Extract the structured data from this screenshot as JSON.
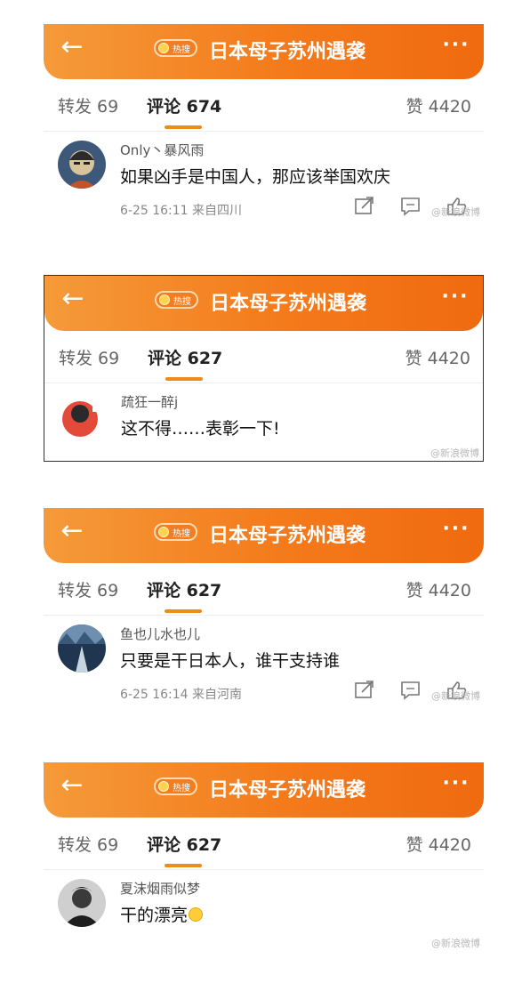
{
  "header": {
    "badge_text": "热搜",
    "title": "日本母子苏州遇袭",
    "back_icon": "arrow-left-icon",
    "more_icon": "more-dots-icon",
    "accent": "#f47a1a"
  },
  "panels": [
    {
      "tabs": {
        "repost": "转发 69",
        "comments": "评论 674",
        "likes": "赞 4420"
      },
      "comment": {
        "username": "Only丶暴风雨",
        "text": "如果凶手是中国人，那应该举国欢庆",
        "meta": "6-25 16:11 来自四川"
      },
      "watermark": "@新浪微博"
    },
    {
      "tabs": {
        "repost": "转发 69",
        "comments": "评论 627",
        "likes": "赞 4420"
      },
      "comment": {
        "username": "疏狂一醉j",
        "text": "这不得……表彰一下!",
        "meta": ""
      },
      "watermark": "@新浪微博"
    },
    {
      "tabs": {
        "repost": "转发 69",
        "comments": "评论 627",
        "likes": "赞 4420"
      },
      "comment": {
        "username": "鱼也儿水也儿",
        "text": "只要是干日本人，谁干支持谁",
        "meta": "6-25 16:14 来自河南"
      },
      "watermark": "@新浪微博"
    },
    {
      "tabs": {
        "repost": "转发 69",
        "comments": "评论 627",
        "likes": "赞 4420"
      },
      "comment": {
        "username": "夏沫烟雨似梦",
        "text": "干的漂亮",
        "meta": ""
      },
      "watermark": "@新浪微博"
    }
  ]
}
